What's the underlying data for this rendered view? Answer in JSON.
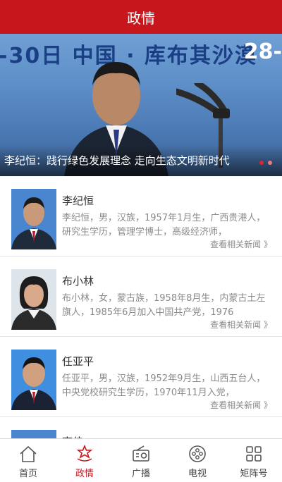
{
  "header": {
    "title": "政情"
  },
  "banner": {
    "bg_text_left": "-30日  中国 · 库布其沙漠",
    "bg_text_right": "28-",
    "caption": "李纪恒：践行绿色发展理念 走向生态文明新时代"
  },
  "items": [
    {
      "name": "李纪恒",
      "desc": "李纪恒，男，汉族，1957年1月生，广西贵港人，研究生学历，管理学博士，高级经济师，",
      "more": "查看相关新闻 》"
    },
    {
      "name": "布小林",
      "desc": "布小林，女，蒙古族，1958年8月生，内蒙古土左旗人，1985年6月加入中国共产党，1976",
      "more": "查看相关新闻 》"
    },
    {
      "name": "任亚平",
      "desc": "任亚平，男，汉族，1952年9月生，山西五台人，中央党校研究生学历，1970年11月入党，",
      "more": "查看相关新闻 》"
    },
    {
      "name": "李佳",
      "desc": "",
      "more": ""
    }
  ],
  "tabs": [
    {
      "label": "首页",
      "icon": "home-icon"
    },
    {
      "label": "政情",
      "icon": "emblem-icon",
      "active": true
    },
    {
      "label": "广播",
      "icon": "radio-icon"
    },
    {
      "label": "电视",
      "icon": "tv-icon"
    },
    {
      "label": "矩阵号",
      "icon": "grid-icon"
    }
  ],
  "colors": {
    "brand": "#c8161d"
  }
}
